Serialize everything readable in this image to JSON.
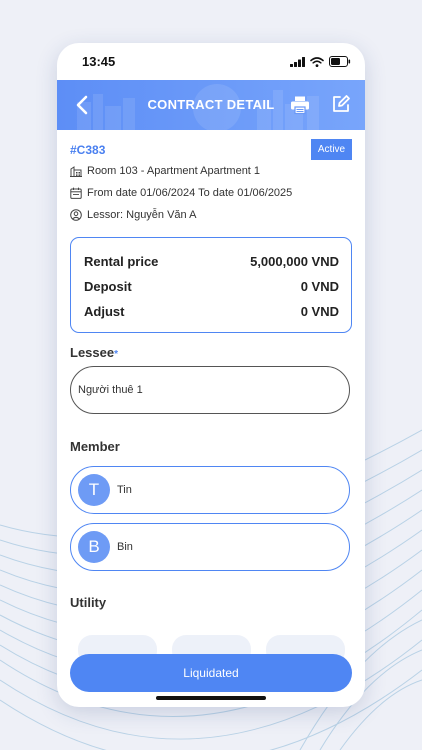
{
  "status_bar": {
    "time": "13:45"
  },
  "header": {
    "title": "CONTRACT DETAIL"
  },
  "contract": {
    "code": "#C383",
    "status": "Active",
    "room": "Room 103 - Apartment Apartment 1",
    "dates": "From date 01/06/2024 To date 01/06/2025",
    "lessor": "Lessor: Nguyễn Văn A"
  },
  "prices": [
    {
      "label": "Rental price",
      "value": "5,000,000 VND"
    },
    {
      "label": "Deposit",
      "value": "0 VND"
    },
    {
      "label": "Adjust",
      "value": "0 VND"
    }
  ],
  "lessee": {
    "label": "Lessee",
    "required_mark": "*",
    "value": "Người thuê 1"
  },
  "members": {
    "label": "Member",
    "items": [
      {
        "initial": "T",
        "name": "Tin"
      },
      {
        "initial": "B",
        "name": "Bin"
      }
    ]
  },
  "utility": {
    "label": "Utility"
  },
  "actions": {
    "liquidate_label": "Liquidated"
  },
  "colors": {
    "primary": "#4f86f3",
    "header_gradient_start": "#5d8ef6",
    "avatar": "#6e9bf5"
  },
  "icons": [
    "back-arrow-icon",
    "printer-icon",
    "edit-icon",
    "building-icon",
    "calendar-icon",
    "user-circle-icon",
    "signal-icon",
    "wifi-icon",
    "battery-icon"
  ]
}
